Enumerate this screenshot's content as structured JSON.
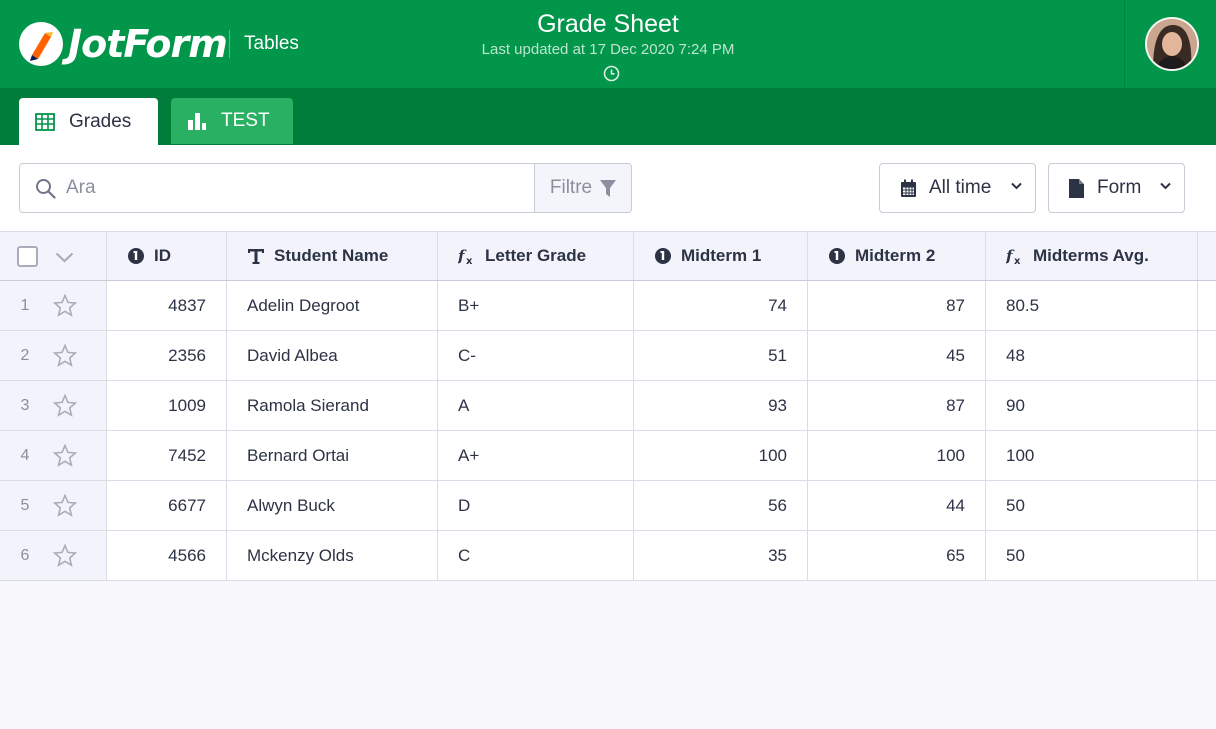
{
  "header": {
    "logo_text": "JotForm",
    "tables_link": "Tables",
    "title": "Grade Sheet",
    "subtitle": "Last updated at 17 Dec 2020 7:24 PM",
    "brand_color": "#01964a"
  },
  "tabs": [
    {
      "label": "Grades",
      "icon": "table-grid-icon",
      "active": true
    },
    {
      "label": "TEST",
      "icon": "bar-chart-icon",
      "active": false
    }
  ],
  "toolbar": {
    "search_placeholder": "Ara",
    "filter_label": "Filtre",
    "time_dropdown": "All time",
    "form_dropdown": "Form"
  },
  "table": {
    "columns": [
      {
        "label": "ID",
        "icon": "info-circle-icon"
      },
      {
        "label": "Student Name",
        "icon": "text-t-icon"
      },
      {
        "label": "Letter Grade",
        "icon": "formula-fx-icon"
      },
      {
        "label": "Midterm 1",
        "icon": "info-circle-icon"
      },
      {
        "label": "Midterm 2",
        "icon": "info-circle-icon"
      },
      {
        "label": "Midterms Avg.",
        "icon": "formula-fx-icon"
      }
    ],
    "rows": [
      {
        "n": "1",
        "id": "4837",
        "name": "Adelin Degroot",
        "grade": "B+",
        "m1": "74",
        "m2": "87",
        "avg": "80.5"
      },
      {
        "n": "2",
        "id": "2356",
        "name": "David Albea",
        "grade": "C-",
        "m1": "51",
        "m2": "45",
        "avg": "48"
      },
      {
        "n": "3",
        "id": "1009",
        "name": "Ramola Sierand",
        "grade": "A",
        "m1": "93",
        "m2": "87",
        "avg": "90"
      },
      {
        "n": "4",
        "id": "7452",
        "name": "Bernard Ortai",
        "grade": "A+",
        "m1": "100",
        "m2": "100",
        "avg": "100"
      },
      {
        "n": "5",
        "id": "6677",
        "name": "Alwyn Buck",
        "grade": "D",
        "m1": "56",
        "m2": "44",
        "avg": "50"
      },
      {
        "n": "6",
        "id": "4566",
        "name": "Mckenzy Olds",
        "grade": "C",
        "m1": "35",
        "m2": "65",
        "avg": "50"
      }
    ]
  }
}
